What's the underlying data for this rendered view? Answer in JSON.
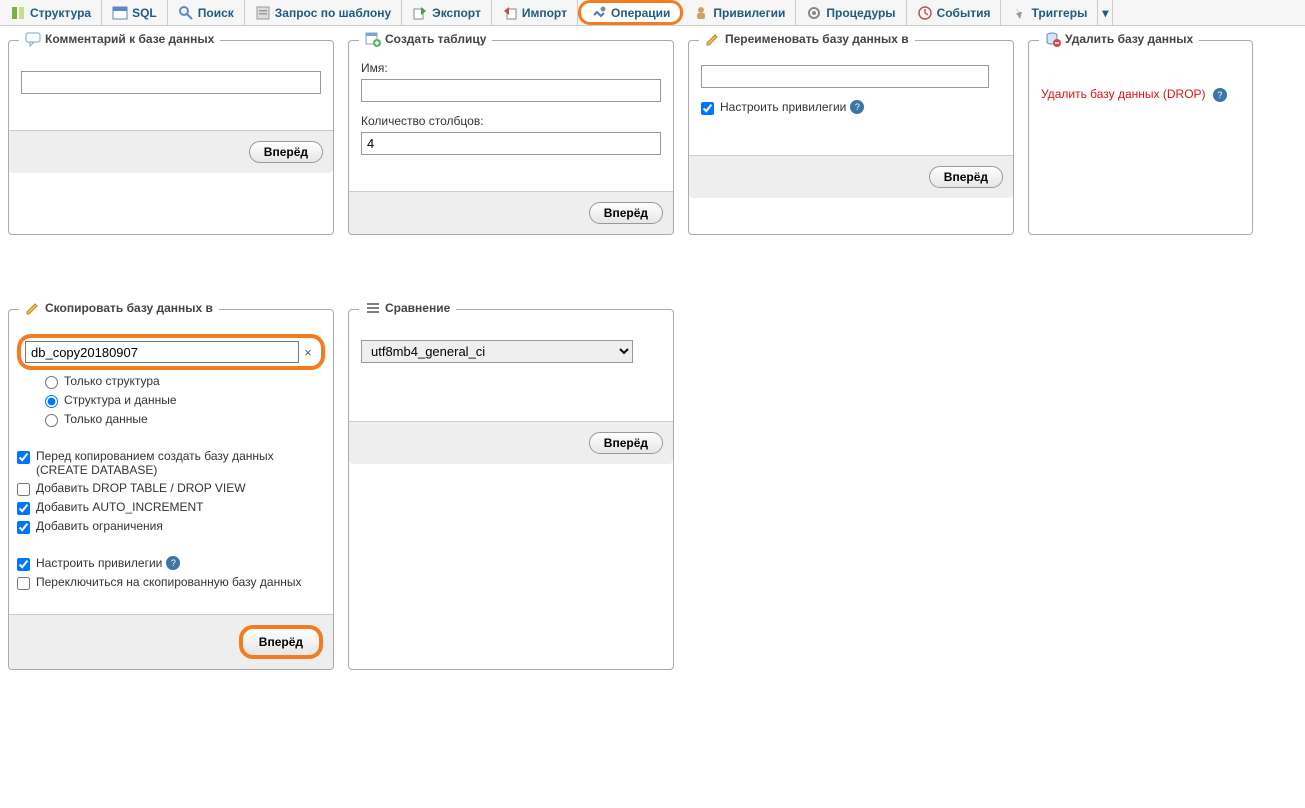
{
  "tabs": {
    "structure": "Структура",
    "sql": "SQL",
    "search": "Поиск",
    "query": "Запрос по шаблону",
    "export": "Экспорт",
    "import": "Импорт",
    "operations": "Операции",
    "privileges": "Привилегии",
    "routines": "Процедуры",
    "events": "События",
    "triggers": "Триггеры"
  },
  "buttons": {
    "go": "Вперёд"
  },
  "panel_comment": {
    "title": "Комментарий к базе данных",
    "value": ""
  },
  "panel_create_table": {
    "title": "Создать таблицу",
    "name_label": "Имя:",
    "name_value": "",
    "columns_label": "Количество столбцов:",
    "columns_value": "4"
  },
  "panel_rename": {
    "title": "Переименовать базу данных в",
    "value": "",
    "adjust_privileges_label": "Настроить привилегии"
  },
  "panel_delete": {
    "title": "Удалить базу данных",
    "link": "Удалить базу данных (DROP)"
  },
  "panel_copy": {
    "title": "Скопировать базу данных в",
    "value": "db_copy20180907",
    "radio_structure_only": "Только структура",
    "radio_structure_data": "Структура и данные",
    "radio_data_only": "Только данные",
    "chk_create_db": "Перед копированием создать базу данных (CREATE DATABASE)",
    "chk_drop": "Добавить DROP TABLE / DROP VIEW",
    "chk_autoinc": "Добавить AUTO_INCREMENT",
    "chk_constraints": "Добавить ограничения",
    "chk_privileges": "Настроить привилегии",
    "chk_switch": "Переключиться на скопированную базу данных"
  },
  "panel_collation": {
    "title": "Сравнение",
    "value": "utf8mb4_general_ci"
  }
}
